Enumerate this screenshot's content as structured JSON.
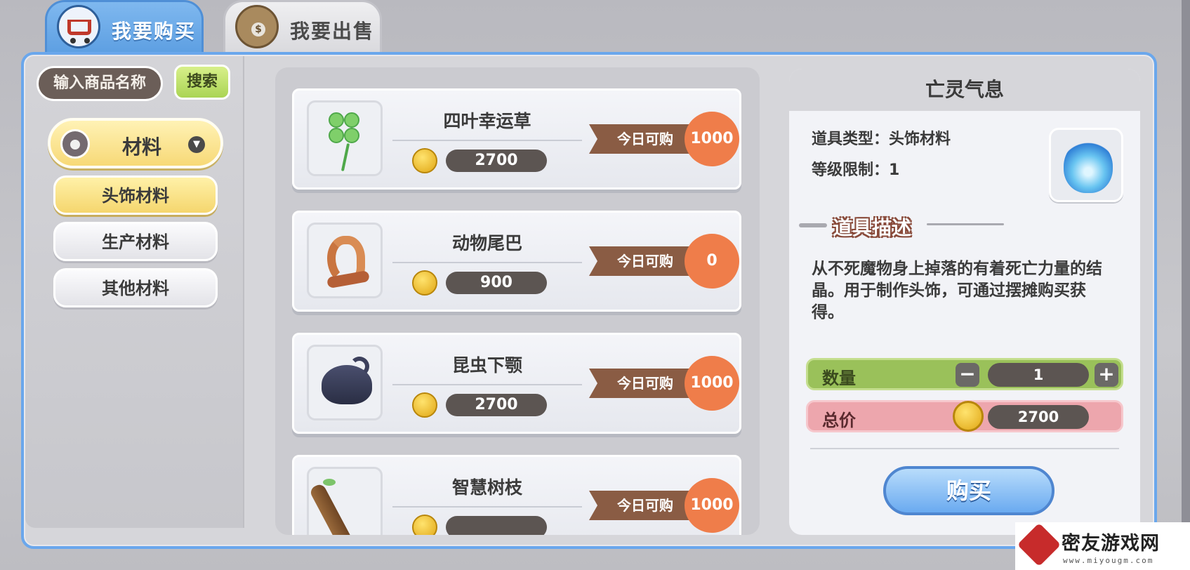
{
  "tabs": [
    {
      "label": "我要购买",
      "icon": "shopping-cart-icon",
      "active": true
    },
    {
      "label": "我要出售",
      "icon": "money-bag-icon",
      "active": false
    }
  ],
  "search": {
    "placeholder": "输入商品名称",
    "button": "搜索"
  },
  "category": {
    "label": "材料",
    "icon": "flask-icon"
  },
  "subcategories": [
    {
      "label": "头饰材料",
      "active": true
    },
    {
      "label": "生产材料",
      "active": false
    },
    {
      "label": "其他材料",
      "active": false
    }
  ],
  "items": [
    {
      "name": "四叶幸运草",
      "price": "2700",
      "quota_label": "今日可购",
      "quota": "1000",
      "icon": "clover-icon"
    },
    {
      "name": "动物尾巴",
      "price": "900",
      "quota_label": "今日可购",
      "quota": "0",
      "icon": "tail-icon"
    },
    {
      "name": "昆虫下颚",
      "price": "2700",
      "quota_label": "今日可购",
      "quota": "1000",
      "icon": "insect-jaw-icon"
    },
    {
      "name": "智慧树枝",
      "price": "",
      "quota_label": "今日可购",
      "quota": "1000",
      "icon": "branch-icon"
    }
  ],
  "detail": {
    "title": "亡灵气息",
    "type": "道具类型：头饰材料",
    "level": "等级限制：1",
    "icon": "blue-flame-icon",
    "desc_title": "道具描述",
    "description": "从不死魔物身上掉落的有着死亡力量的结晶。用于制作头饰，可通过摆摊购买获得。",
    "qty_label": "数量",
    "qty": "1",
    "total_label": "总价",
    "total": "2700",
    "buy_button": "购买"
  },
  "watermark": {
    "text": "密友游戏网",
    "url": "www.miyougm.com"
  }
}
